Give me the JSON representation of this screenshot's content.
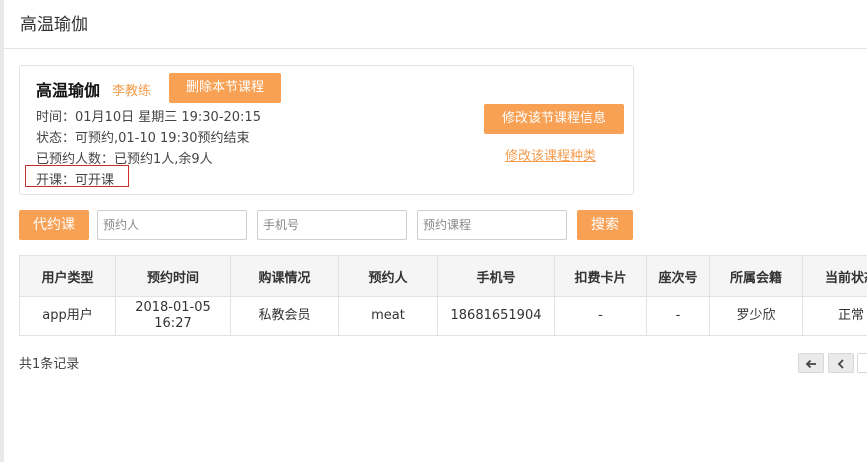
{
  "header": {
    "title": "高温瑜伽"
  },
  "course": {
    "name": "高温瑜伽",
    "coach": "李教练",
    "delete_label": "删除本节课程",
    "time": "时间：01月10日 星期三 19:30-20:15",
    "status": "状态：可预约,01-10 19:30预约结束",
    "booked": "已预约人数：已预约1人,余9人",
    "open": "开课：可开课",
    "edit_info_label": "修改该节课程信息",
    "edit_type_label": "修改该课程种类"
  },
  "toolbar": {
    "book_for_label": "代约课",
    "person_placeholder": "预约人",
    "phone_placeholder": "手机号",
    "course_placeholder": "预约课程",
    "search_label": "搜索"
  },
  "table": {
    "headers": [
      "用户类型",
      "预约时间",
      "购课情况",
      "预约人",
      "手机号",
      "扣费卡片",
      "座次号",
      "所属会籍",
      "当前状态"
    ],
    "rows": [
      {
        "user_type": "app用户",
        "time_date": "2018-01-05",
        "time_clock": "16:27",
        "purchase": "私教会员",
        "booker": "meat",
        "phone": "18681651904",
        "card": "-",
        "seat": "-",
        "membership": "罗少欣",
        "status": "正常"
      }
    ]
  },
  "footer": {
    "count": "共1条记录"
  },
  "pager": {
    "first_icon": "arrow-left-icon",
    "prev_icon": "chevron-left-icon"
  }
}
